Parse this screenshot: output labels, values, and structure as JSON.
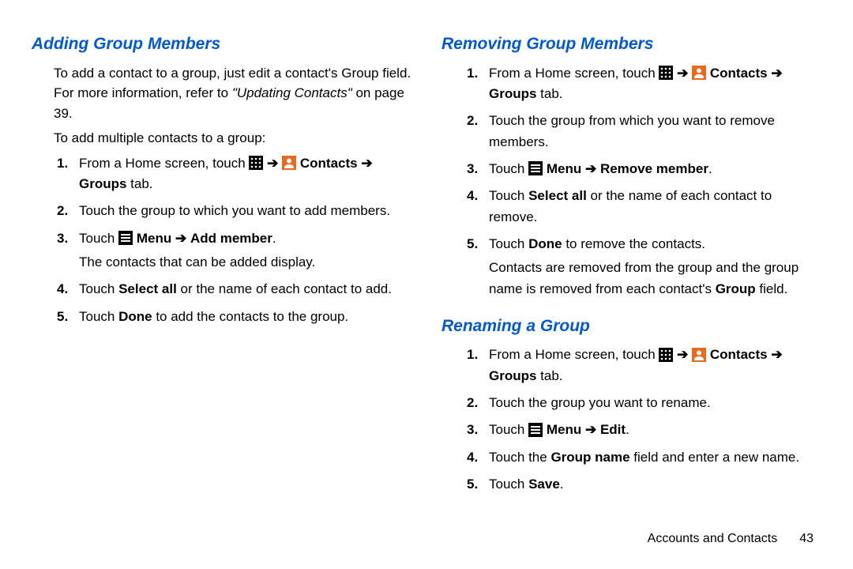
{
  "footer": {
    "section": "Accounts and Contacts",
    "page": "43"
  },
  "left": {
    "h1": "Adding Group Members",
    "intro1": "To add a contact to a group, just edit a contact's Group field. For more information, refer to ",
    "intro_ital": "\"Updating Contacts\"",
    "intro2": " on page 39.",
    "lead": "To add multiple contacts to a group:",
    "s1a": "From a Home screen, touch ",
    "s1b": "Contacts",
    "s1c": "Groups",
    "s1d": " tab.",
    "s2": "Touch the group to which you want to add members.",
    "s3a": "Touch ",
    "s3b": "Menu",
    "s3c": "Add member",
    "s3note": "The contacts that can be added display.",
    "s4a": "Touch ",
    "s4b": "Select all",
    "s4c": " or the name of each contact to add.",
    "s5a": "Touch ",
    "s5b": "Done",
    "s5c": " to add the contacts to the group."
  },
  "rightA": {
    "h1": "Removing Group Members",
    "s1a": "From a Home screen, touch ",
    "s1b": "Contacts",
    "s1c": "Groups",
    "s1d": " tab.",
    "s2": "Touch the group from which you want to remove members.",
    "s3a": "Touch ",
    "s3b": "Menu",
    "s3c": "Remove member",
    "s4a": "Touch ",
    "s4b": "Select all",
    "s4c": " or the name of each contact to remove.",
    "s5a": "Touch ",
    "s5b": "Done",
    "s5c": " to remove the contacts.",
    "note1": "Contacts are removed from the group and the group name is removed from each contact's ",
    "note2": "Group",
    "note3": " field."
  },
  "rightB": {
    "h1": "Renaming a Group",
    "s1a": "From a Home screen, touch ",
    "s1b": "Contacts",
    "s1c": "Groups",
    "s1d": " tab.",
    "s2": "Touch the group you want to rename.",
    "s3a": "Touch ",
    "s3b": "Menu",
    "s3c": "Edit",
    "s4a": "Touch the ",
    "s4b": "Group name",
    "s4c": " field and enter a new name.",
    "s5a": "Touch ",
    "s5b": "Save"
  },
  "glyphs": {
    "arrow": "➔"
  }
}
